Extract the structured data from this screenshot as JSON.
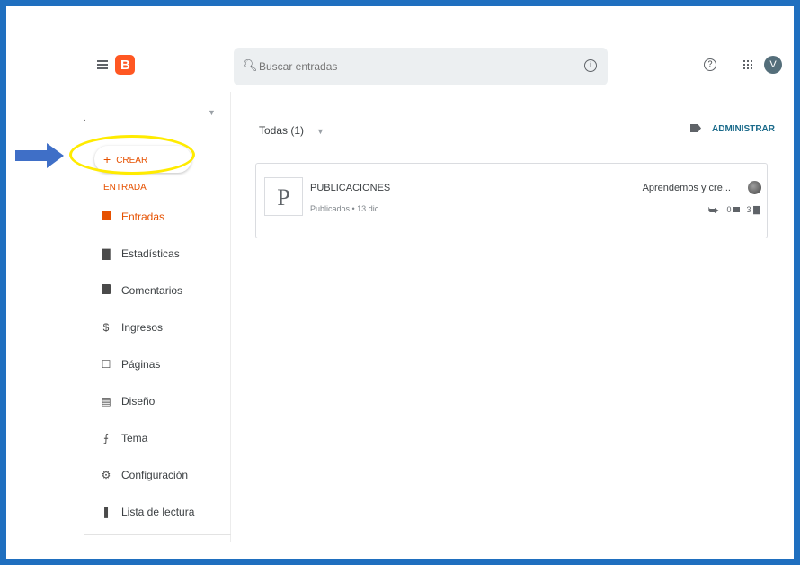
{
  "header": {
    "search_placeholder": "Buscar entradas",
    "avatar_letter": "V"
  },
  "sidebar": {
    "blog_name": ".",
    "create_button": "CREAR ENTRADA",
    "items": [
      {
        "label": "Entradas",
        "icon": "posts-icon",
        "active": true
      },
      {
        "label": "Estadísticas",
        "icon": "stats-icon",
        "active": false
      },
      {
        "label": "Comentarios",
        "icon": "comments-icon",
        "active": false
      },
      {
        "label": "Ingresos",
        "icon": "dollar-icon",
        "active": false
      },
      {
        "label": "Páginas",
        "icon": "pages-icon",
        "active": false
      },
      {
        "label": "Diseño",
        "icon": "layout-icon",
        "active": false
      },
      {
        "label": "Tema",
        "icon": "theme-icon",
        "active": false
      },
      {
        "label": "Configuración",
        "icon": "settings-icon",
        "active": false
      },
      {
        "label": "Lista de lectura",
        "icon": "bookmark-icon",
        "active": false
      }
    ]
  },
  "main": {
    "filter_label": "Todas (1)",
    "admin_label": "ADMINISTRAR",
    "post": {
      "thumb_letter": "P",
      "title": "PUBLICACIONES",
      "meta": "Publicados • 13 dic",
      "author": "Aprendemos y cre...",
      "comments": "0",
      "views": "3"
    }
  },
  "colors": {
    "accent": "#e65100",
    "frame": "#1f6fbf",
    "highlight": "#ffeb00",
    "arrow": "#3f6fc7"
  }
}
